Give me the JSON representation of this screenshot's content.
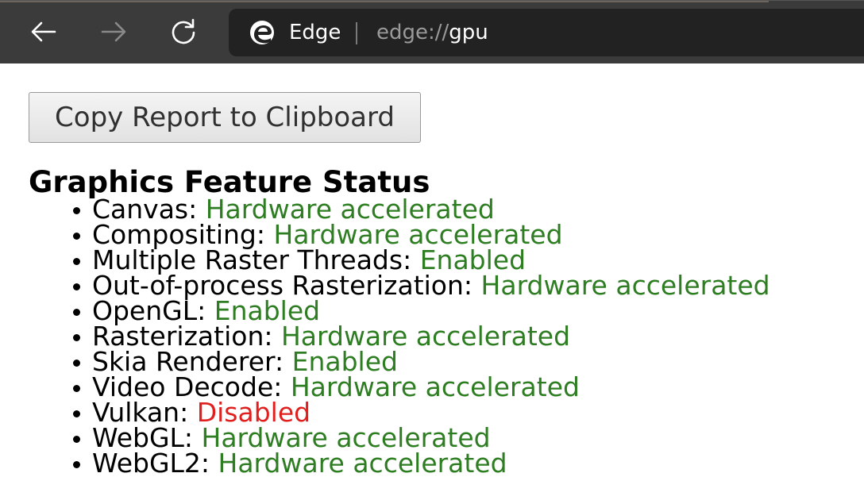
{
  "browser": {
    "site_name": "Edge",
    "url_scheme": "edge://",
    "url_host": "gpu"
  },
  "page": {
    "copy_button_label": "Copy Report to Clipboard",
    "heading": "Graphics Feature Status",
    "features": [
      {
        "name": "Canvas: ",
        "status": "Hardware accelerated",
        "state": "ok"
      },
      {
        "name": "Compositing: ",
        "status": "Hardware accelerated",
        "state": "ok"
      },
      {
        "name": "Multiple Raster Threads: ",
        "status": "Enabled",
        "state": "ok"
      },
      {
        "name": "Out-of-process Rasterization: ",
        "status": "Hardware accelerated",
        "state": "ok"
      },
      {
        "name": "OpenGL: ",
        "status": "Enabled",
        "state": "ok"
      },
      {
        "name": "Rasterization: ",
        "status": "Hardware accelerated",
        "state": "ok"
      },
      {
        "name": "Skia Renderer: ",
        "status": "Enabled",
        "state": "ok"
      },
      {
        "name": "Video Decode: ",
        "status": "Hardware accelerated",
        "state": "ok"
      },
      {
        "name": "Vulkan: ",
        "status": "Disabled",
        "state": "bad"
      },
      {
        "name": "WebGL: ",
        "status": "Hardware accelerated",
        "state": "ok"
      },
      {
        "name": "WebGL2: ",
        "status": "Hardware accelerated",
        "state": "ok"
      }
    ]
  },
  "colors": {
    "status_ok": "#2e7d22",
    "status_bad": "#e0201e",
    "toolbar_bg": "#3b3b3b",
    "addressbar_bg": "#222222"
  },
  "icons": {
    "back": "back-arrow-icon",
    "forward": "forward-arrow-icon",
    "refresh": "refresh-icon",
    "logo": "edge-logo-icon"
  }
}
